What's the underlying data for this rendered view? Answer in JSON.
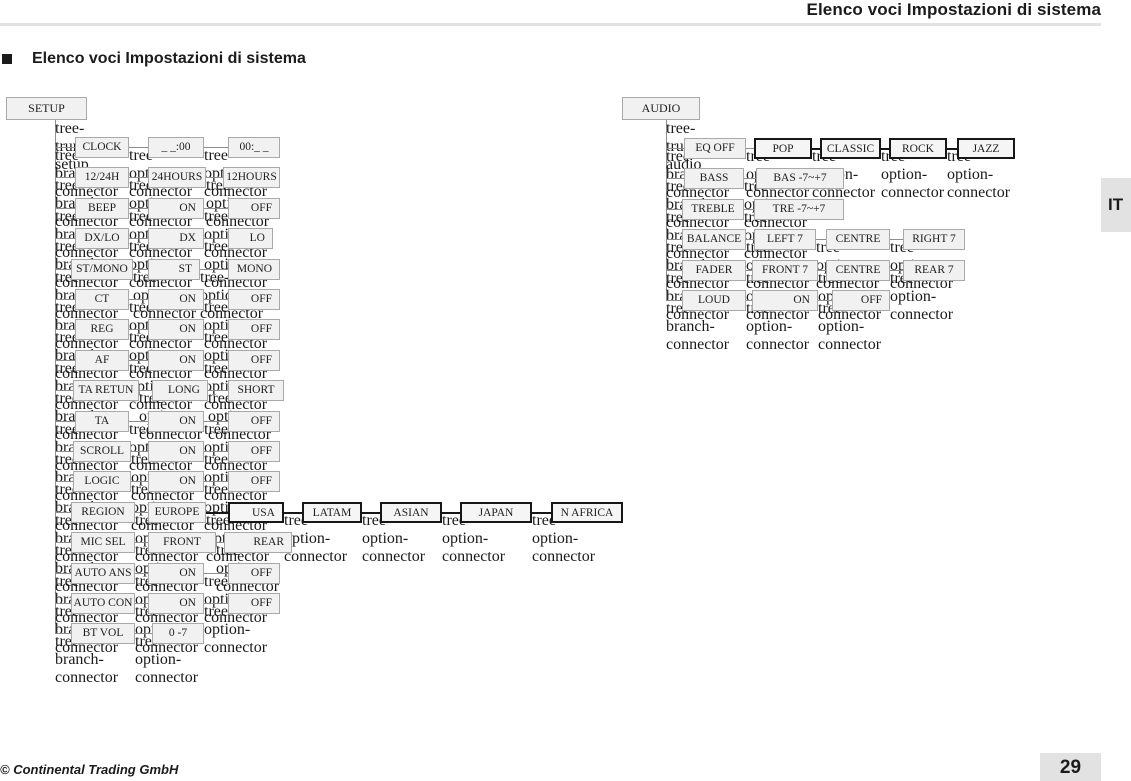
{
  "header": {
    "title": "Elenco voci Impostazioni di sistema"
  },
  "section": {
    "heading": "Elenco voci Impostazioni di sistema",
    "bullet_icon": "square-bullet-icon"
  },
  "language_tab": {
    "label": "IT"
  },
  "footer": {
    "copyright": "© Continental Trading GmbH",
    "page_number": "29"
  },
  "colors": {
    "box_fill": "#f1f1f1",
    "box_border": "#a9a9a9",
    "box_border_dark": "#171717",
    "line": "#8e8e8e",
    "tab_fill": "#e2e2e2",
    "text": "#1d1d1d"
  },
  "trees": [
    {
      "id": "setup",
      "root": "SETUP",
      "rows": [
        {
          "label": "CLOCK",
          "options": [
            "_ _:00",
            "00:_ _"
          ]
        },
        {
          "label": "12/24H",
          "options": [
            "24HOURS",
            "12HOURS"
          ]
        },
        {
          "label": "BEEP",
          "options": [
            "ON",
            "OFF"
          ]
        },
        {
          "label": "DX/LO",
          "options": [
            "DX",
            "LO"
          ]
        },
        {
          "label": "ST/MONO",
          "options": [
            "ST",
            "MONO"
          ]
        },
        {
          "label": "CT",
          "options": [
            "ON",
            "OFF"
          ]
        },
        {
          "label": "REG",
          "options": [
            "ON",
            "OFF"
          ]
        },
        {
          "label": "AF",
          "options": [
            "ON",
            "OFF"
          ]
        },
        {
          "label": "TA RETUN",
          "options": [
            "LONG",
            "SHORT"
          ]
        },
        {
          "label": "TA",
          "options": [
            "ON",
            "OFF"
          ]
        },
        {
          "label": "SCROLL",
          "options": [
            "ON",
            "OFF"
          ]
        },
        {
          "label": "LOGIC",
          "options": [
            "ON",
            "OFF"
          ]
        },
        {
          "label": "REGION",
          "options": [
            "EUROPE",
            "USA",
            "LATAM",
            "ASIAN",
            "JAPAN",
            "N AFRICA"
          ]
        },
        {
          "label": "MIC SEL",
          "options": [
            "FRONT",
            "REAR"
          ]
        },
        {
          "label": "AUTO ANS",
          "options": [
            "ON",
            "OFF"
          ]
        },
        {
          "label": "AUTO CON",
          "options": [
            "ON",
            "OFF"
          ]
        },
        {
          "label": "BT VOL",
          "options": [
            "0 -7"
          ]
        }
      ]
    },
    {
      "id": "audio",
      "root": "AUDIO",
      "rows": [
        {
          "label": "EQ OFF",
          "options": [
            "POP",
            "CLASSIC",
            "ROCK",
            "JAZZ"
          ]
        },
        {
          "label": "BASS",
          "options": [
            "BAS -7~+7"
          ]
        },
        {
          "label": "TREBLE",
          "options": [
            "TRE -7~+7"
          ]
        },
        {
          "label": "BALANCE",
          "options": [
            "LEFT 7",
            "CENTRE",
            "RIGHT 7"
          ]
        },
        {
          "label": "FADER",
          "options": [
            "FRONT 7",
            "CENTRE",
            "REAR 7"
          ]
        },
        {
          "label": "LOUD",
          "options": [
            "ON",
            "OFF"
          ]
        }
      ]
    }
  ]
}
